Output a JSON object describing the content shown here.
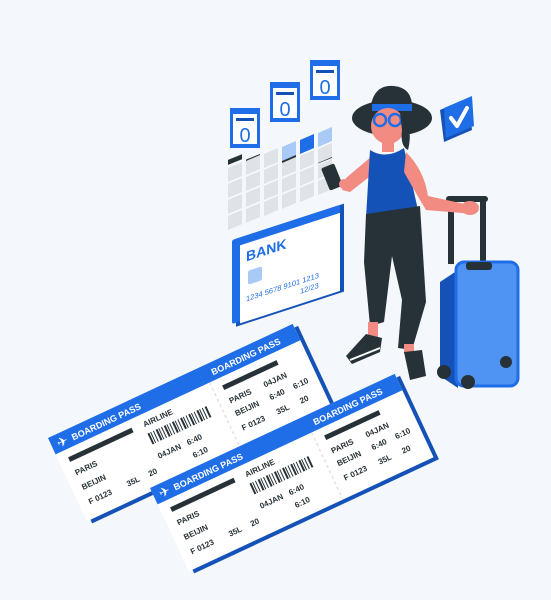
{
  "colors": {
    "background": "#f4f7fb",
    "primary_blue": "#1f6ee8",
    "dark_blue": "#1552b8",
    "light_blue": "#4f94f2",
    "pale_blue": "#a9c9f7",
    "ink": "#263238",
    "skin": "#f28b82",
    "white": "#ffffff",
    "grey": "#dfe3e8"
  },
  "calendar": {
    "days": [
      "0",
      "0",
      "0"
    ]
  },
  "bank_card": {
    "brand": "BANK",
    "number": "1234  5678  9101  1213",
    "expiry": "12/23"
  },
  "tickets": [
    {
      "header_left": "BOARDING PASS",
      "header_right": "BOARDING PASS",
      "airline": "AIRLINE",
      "from_city": "PARIS",
      "to_city": "BEIJIN",
      "flight": "F 0123",
      "seat": "35L",
      "gate": "20",
      "dep_time": "6:40",
      "arr_time": "6:10",
      "date": "04JAN"
    },
    {
      "header_left": "BOARDING PASS",
      "header_right": "BOARDING PASS",
      "airline": "AIRLINE",
      "from_city": "PARIS",
      "to_city": "BEIJIN",
      "flight": "F 0123",
      "seat": "35L",
      "gate": "20",
      "dep_time": "6:40",
      "arr_time": "6:10",
      "date": "04JAN"
    }
  ]
}
